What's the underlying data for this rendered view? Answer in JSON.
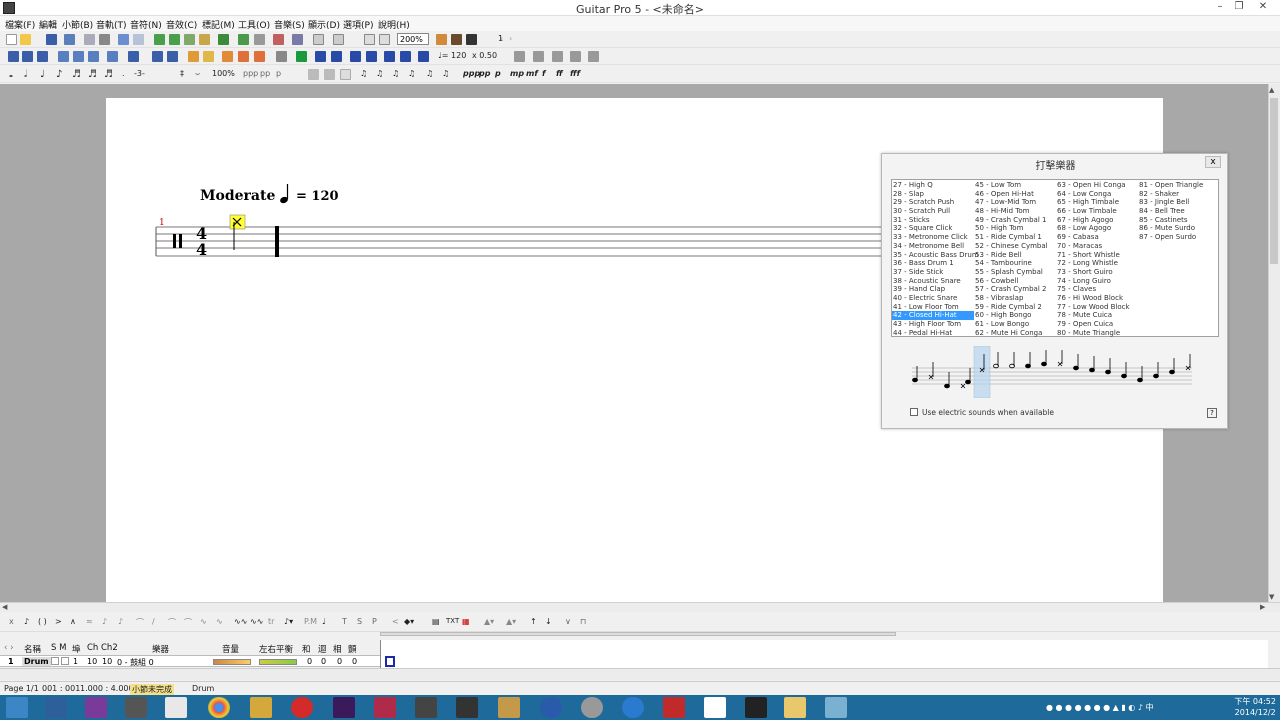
{
  "window": {
    "title": "Guitar Pro 5 - <未命名>"
  },
  "menu": [
    "檔案(F)",
    "編輯",
    "小節(B)",
    "音軌(T)",
    "音符(N)",
    "音效(C)",
    "標記(M)",
    "工具(O)",
    "音樂(S)",
    "顯示(D)",
    "選項(P)",
    "說明(H)"
  ],
  "toolbar": {
    "zoom": "200%",
    "page_num": "1",
    "tempo": "♩= 120",
    "speed": "x 0.50",
    "velocity_percent": "100%"
  },
  "score": {
    "tempo_text": "Moderate",
    "tempo_value": "= 120",
    "bar_number": "1",
    "time_signature_top": "4",
    "time_signature_bottom": "4"
  },
  "drum_panel": {
    "title": "打擊樂器",
    "close": "x",
    "columns": [
      [
        "27 - High Q",
        "28 - Slap",
        "29 - Scratch Push",
        "30 - Scratch Pull",
        "31 - Sticks",
        "32 - Square Click",
        "33 - Metronome Click",
        "34 - Metronome Bell",
        "35 - Acoustic Bass Drum",
        "36 - Bass Drum 1",
        "37 - Side Stick",
        "38 - Acoustic Snare",
        "39 - Hand Clap",
        "40 - Electric Snare",
        "41 - Low Floor Tom",
        "42 - Closed Hi-Hat",
        "43 - High Floor Tom",
        "44 - Pedal Hi-Hat"
      ],
      [
        "45 - Low Tom",
        "46 - Open Hi-Hat",
        "47 - Low-Mid Tom",
        "48 - Hi-Mid Tom",
        "49 - Crash Cymbal 1",
        "50 - High Tom",
        "51 - Ride Cymbal 1",
        "52 - Chinese Cymbal",
        "53 - Ride Bell",
        "54 - Tambourine",
        "55 - Splash Cymbal",
        "56 - Cowbell",
        "57 - Crash Cymbal 2",
        "58 - Vibraslap",
        "59 - Ride Cymbal 2",
        "60 - High Bongo",
        "61 - Low Bongo",
        "62 - Mute Hi Conga"
      ],
      [
        "63 - Open Hi Conga",
        "64 - Low Conga",
        "65 - High Timbale",
        "66 - Low Timbale",
        "67 - High Agogo",
        "68 - Low Agogo",
        "69 - Cabasa",
        "70 - Maracas",
        "71 - Short Whistle",
        "72 - Long Whistle",
        "73 - Short Guiro",
        "74 - Long Guiro",
        "75 - Claves",
        "76 - Hi Wood Block",
        "77 - Low Wood Block",
        "78 - Mute Cuica",
        "79 - Open Cuica",
        "80 - Mute Triangle"
      ],
      [
        "81 - Open Triangle",
        "82 - Shaker",
        "83 - Jingle Bell",
        "84 - Bell Tree",
        "85 - Castinets",
        "86 - Mute Surdo",
        "87 - Open Surdo"
      ]
    ],
    "selected": "42 - Closed Hi-Hat",
    "electric_label": "Use electric sounds when available",
    "help": "?"
  },
  "track_header": {
    "name": "名稱",
    "solo_mute": "S M",
    "port": "埠",
    "ch": "Ch",
    "ch2": "Ch2",
    "instrument": "樂器",
    "volume": "音量",
    "pan": "左右平衡",
    "chorus": "和",
    "reverb": "迴",
    "phaser": "相",
    "tremolo": "顫"
  },
  "track": {
    "num": "1",
    "name": "Drum",
    "port": "1",
    "ch": "10",
    "ch2": "10",
    "instrument": "0 - 鼓組 0",
    "vals": [
      "0",
      "0",
      "0",
      "0"
    ]
  },
  "status": {
    "page": "Page 1/1",
    "bar": "001 : 001",
    "time": "1.000 : 4.000",
    "message": "小節未完成",
    "track": "Drum"
  },
  "clock": {
    "time": "下午 04:52",
    "date": "2014/12/2"
  },
  "colors": {
    "selected_blue": "#3399ff",
    "taskbar": "#1e6a9a",
    "note_yellow": "#ffff33",
    "barnum_red": "#cc0000"
  }
}
